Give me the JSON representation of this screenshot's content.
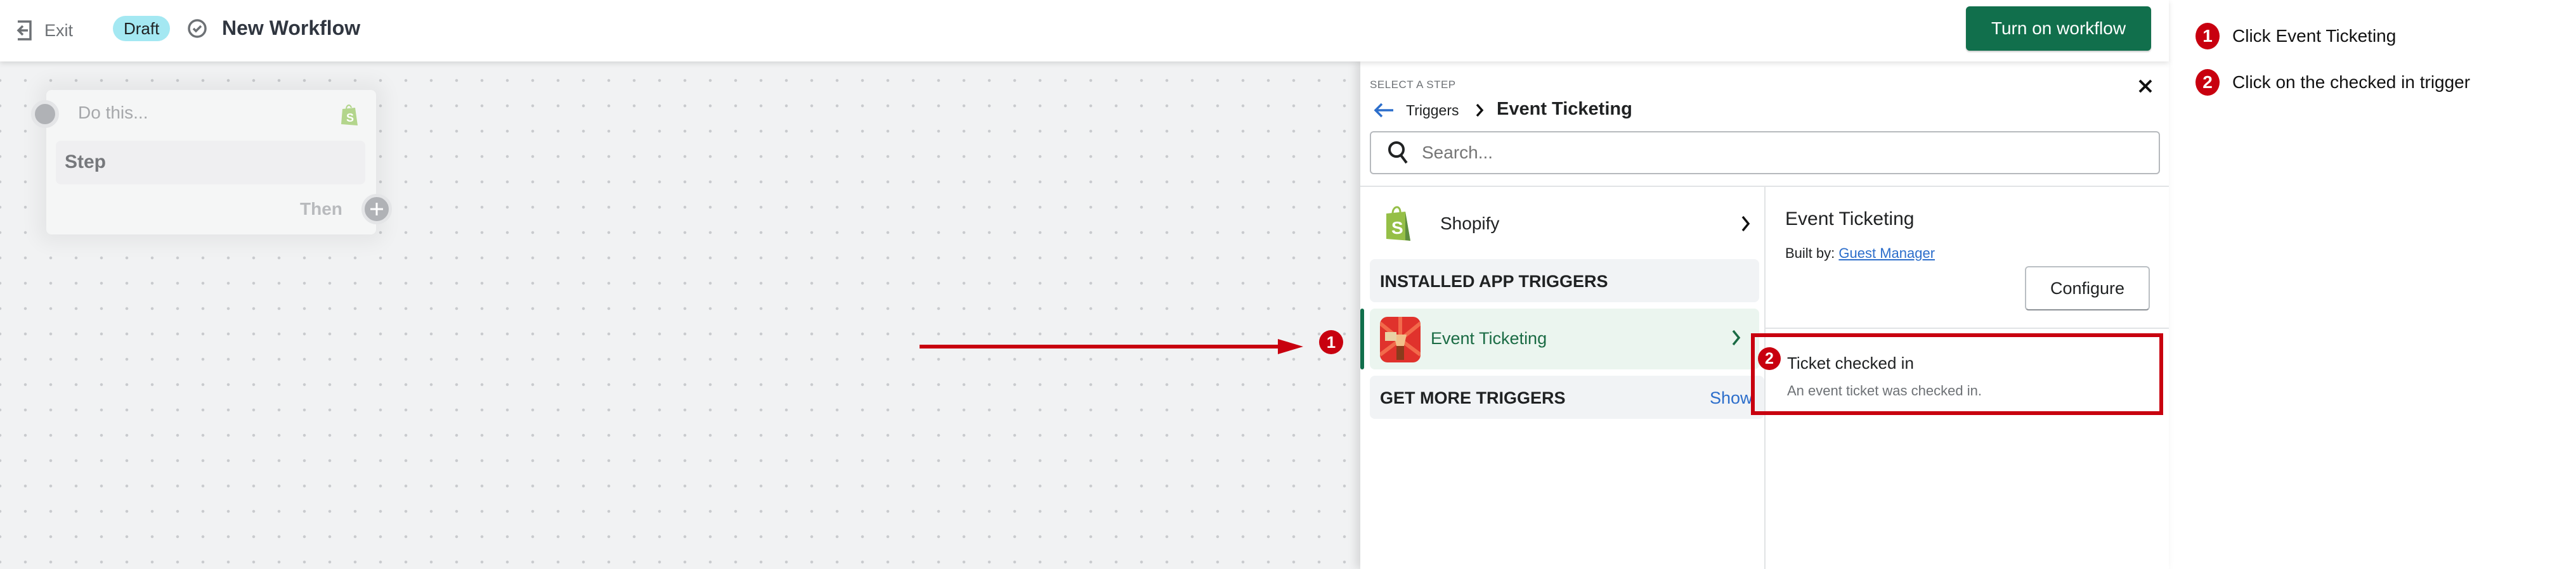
{
  "header": {
    "exit_label": "Exit",
    "status_badge": "Draft",
    "title": "New Workflow",
    "primary_button": "Turn on workflow"
  },
  "canvas": {
    "node": {
      "placeholder": "Do this...",
      "step_label": "Step",
      "then_label": "Then"
    }
  },
  "panel": {
    "eyebrow": "SELECT A STEP",
    "breadcrumb": {
      "parent": "Triggers",
      "current": "Event Ticketing"
    },
    "search": {
      "placeholder": "Search...",
      "value": ""
    },
    "list": {
      "shopify": "Shopify",
      "installed_header": "INSTALLED APP TRIGGERS",
      "selected_app": "Event Ticketing",
      "more_header": "GET MORE TRIGGERS",
      "more_link": "Show"
    },
    "detail": {
      "title": "Event Ticketing",
      "built_by_label": "Built by:",
      "built_by_link": "Guest Manager",
      "configure_button": "Configure",
      "trigger": {
        "title": "Ticket checked in",
        "description": "An event ticket was checked in."
      }
    }
  },
  "annotations": {
    "steps": [
      {
        "number": "1",
        "text": "Click Event Ticketing"
      },
      {
        "number": "2",
        "text": "Click on the checked in trigger"
      }
    ]
  },
  "colors": {
    "primary": "#116f4c",
    "annotation_red": "#c8000f",
    "badge": "#a4e8f2",
    "link": "#2c6ecb"
  }
}
